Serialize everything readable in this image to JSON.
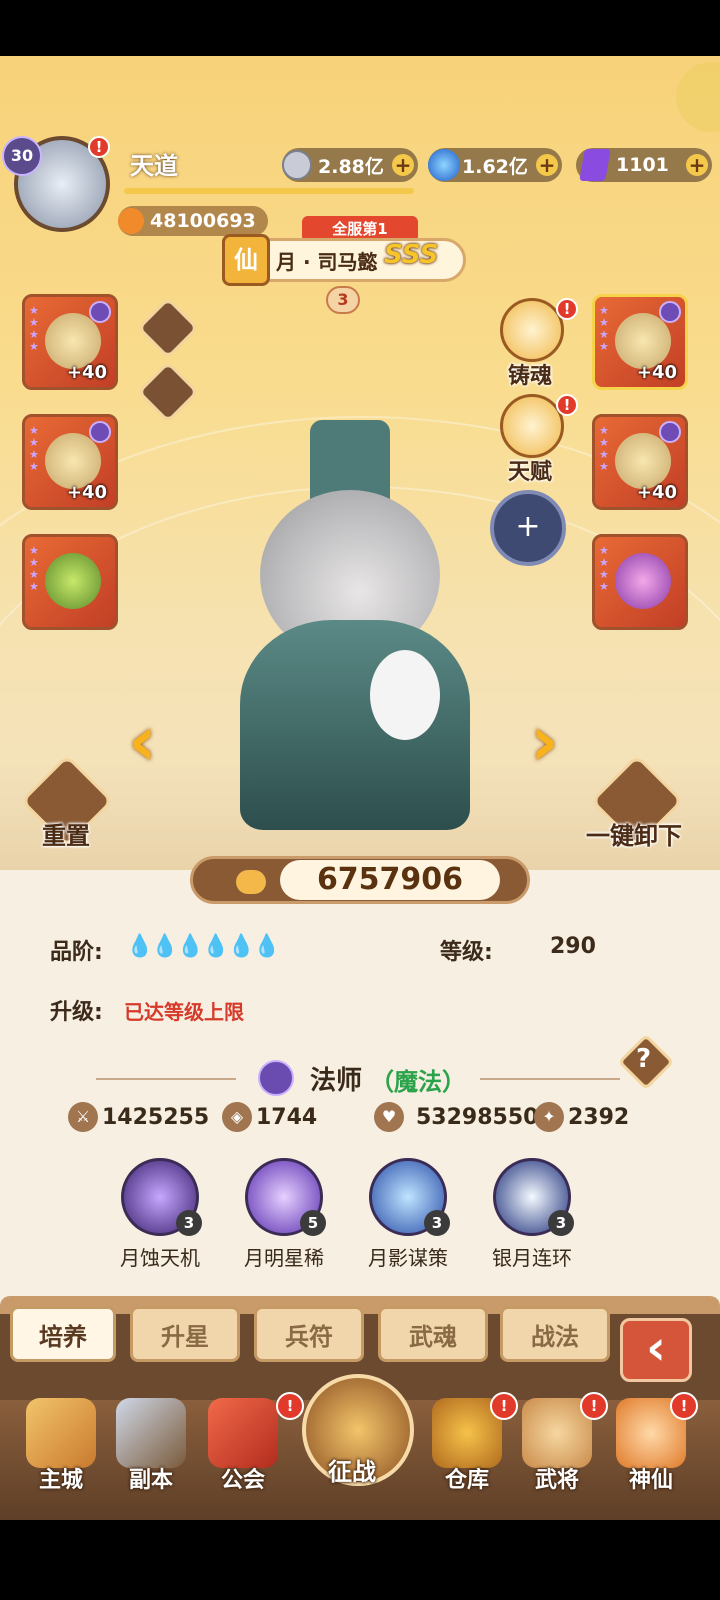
{
  "player": {
    "level": "30",
    "name": "天道",
    "paw_power": "48100693"
  },
  "currencies": [
    {
      "icon": "coin-icon",
      "value": "2.88亿"
    },
    {
      "icon": "orb-icon",
      "value": "1.62亿"
    },
    {
      "icon": "crystal-icon",
      "value": "1101"
    }
  ],
  "hero": {
    "rank_badge": "全服第1",
    "class_tag": "仙",
    "name": "月 · 司马懿",
    "grade": "SSS",
    "star_level": "3",
    "power": "6757906"
  },
  "equip_levels": {
    "left1": "+40",
    "left2": "+40",
    "right1": "+40",
    "right2": "+40"
  },
  "side_actions": {
    "forge": "铸魂",
    "talent": "天赋",
    "reset": "重置",
    "unequip": "一键卸下"
  },
  "info": {
    "quality_label": "品阶:",
    "level_label": "等级:",
    "level_value": "290",
    "upgrade_label": "升级:",
    "upgrade_status": "已达等级上限",
    "class_name": "法师",
    "class_type": "（魔法）",
    "help": "?"
  },
  "stats": [
    {
      "icon": "sword-icon",
      "value": "1425255"
    },
    {
      "icon": "shield-icon",
      "value": "1744"
    },
    {
      "icon": "heart-icon",
      "value": "53298550"
    },
    {
      "icon": "boot-icon",
      "value": "2392"
    }
  ],
  "skills": [
    {
      "name": "月蚀天机",
      "level": "3"
    },
    {
      "name": "月明星稀",
      "level": "5"
    },
    {
      "name": "月影谋策",
      "level": "3"
    },
    {
      "name": "银月连环",
      "level": "3"
    }
  ],
  "tabs": [
    "培养",
    "升星",
    "兵符",
    "武魂",
    "战法"
  ],
  "nav": [
    "主城",
    "副本",
    "公会",
    "征战",
    "仓库",
    "武将",
    "神仙"
  ],
  "colors": {
    "accent": "#f7b21d",
    "alert": "#e23a2a",
    "upgrade_status": "#d73a2a",
    "class_type": "#2aa34a"
  }
}
